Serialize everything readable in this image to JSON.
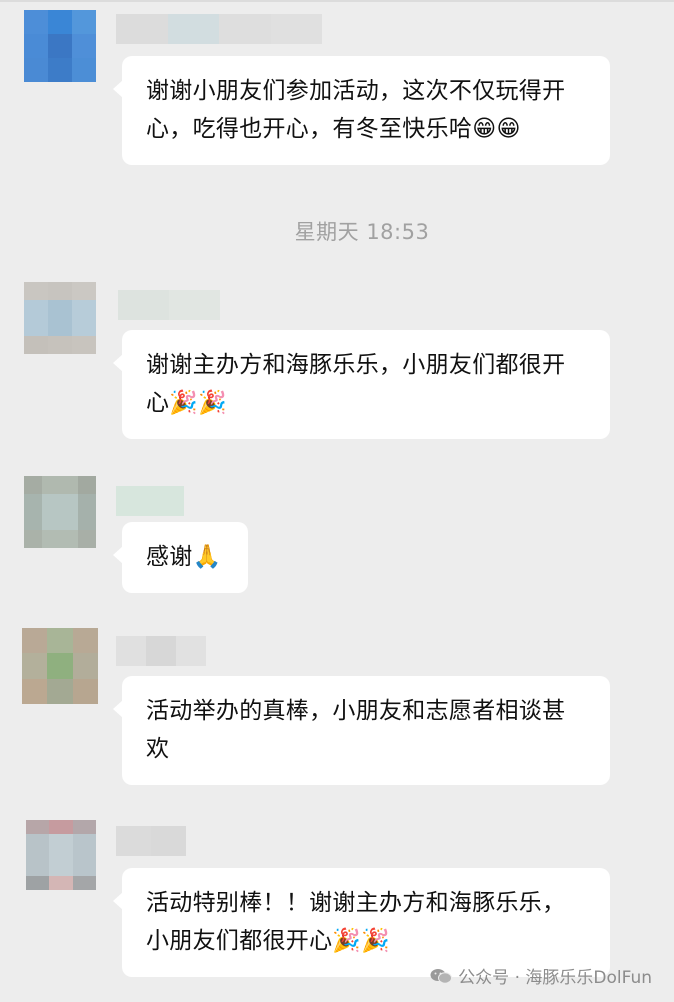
{
  "chat": {
    "messages": [
      {
        "text": "谢谢小朋友们参加活动，这次不仅玩得开心，吃得也开心，有冬至快乐哈😁😁"
      },
      {
        "text": "谢谢主办方和海豚乐乐，小朋友们都很开心🎉🎉"
      },
      {
        "text": "感谢🙏"
      },
      {
        "text": "活动举办的真棒，小朋友和志愿者相谈甚欢"
      },
      {
        "text": "活动特别棒！！谢谢主办方和海豚乐乐，小朋友们都很开心🎉🎉"
      }
    ],
    "timestamp": "星期天 18:53"
  },
  "watermark": {
    "text": "公众号 · 海豚乐乐DolFun",
    "icon": "wechat-icon"
  },
  "colors": {
    "background": "#ededed",
    "bubble": "#ffffff",
    "text": "#111111",
    "meta_text": "#a1a1a1"
  }
}
